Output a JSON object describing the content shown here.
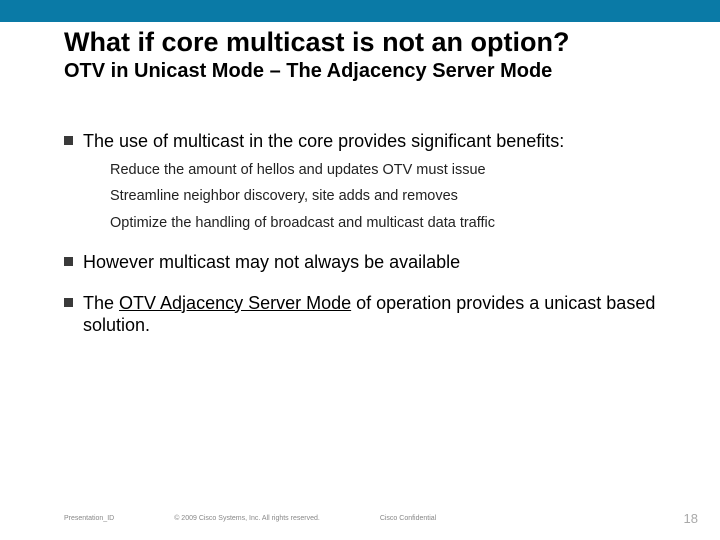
{
  "header": {
    "title": "What if core multicast is not an option?",
    "subtitle": "OTV in Unicast Mode – The Adjacency Server Mode"
  },
  "bullets": [
    {
      "text": "The use of multicast in the core provides significant benefits:",
      "sub": [
        "Reduce the amount of hellos and updates OTV must issue",
        "Streamline neighbor discovery, site adds and removes",
        "Optimize the handling of broadcast and multicast data traffic"
      ]
    },
    {
      "text": "However multicast may not always be available",
      "sub": []
    },
    {
      "pre": "The ",
      "uline": "OTV Adjacency Server Mode",
      "post": "  of operation provides a unicast based solution.",
      "sub": []
    }
  ],
  "footer": {
    "presentation_id": "Presentation_ID",
    "copyright": "© 2009 Cisco Systems, Inc. All rights reserved.",
    "confidential": "Cisco Confidential",
    "page": "18"
  }
}
